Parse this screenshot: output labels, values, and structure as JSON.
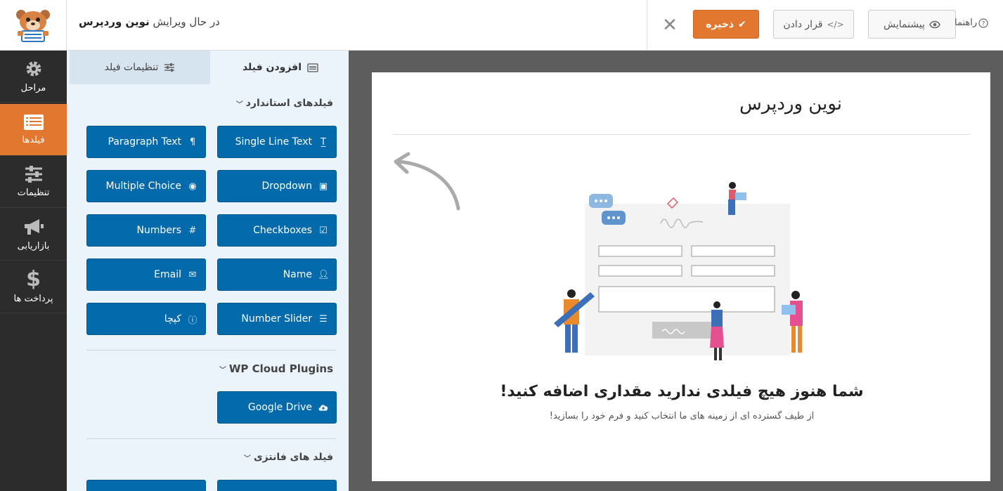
{
  "header": {
    "editing_prefix": "در حال ویرایش",
    "form_name": "نوین وردپرس",
    "save_label": "ذخیره",
    "embed_label": "قرار دادن",
    "preview_label": "پیشنمایش",
    "help_label": "راهنما"
  },
  "sidebar": {
    "items": [
      {
        "label": "مراحل",
        "icon": "gear-icon"
      },
      {
        "label": "فیلدها",
        "icon": "fields-icon"
      },
      {
        "label": "تنظیمات",
        "icon": "sliders-icon"
      },
      {
        "label": "بازاریابی",
        "icon": "megaphone-icon"
      },
      {
        "label": "پرداخت ها",
        "icon": "dollar-icon"
      }
    ]
  },
  "panel": {
    "tab_add": "افزودن فیلد",
    "tab_options": "تنظیمات فیلد",
    "standard_title": "فیلدهای استاندارد",
    "standard_fields": [
      {
        "label": "Single Line Text",
        "icon": "text-icon"
      },
      {
        "label": "Paragraph Text",
        "icon": "paragraph-icon"
      },
      {
        "label": "Dropdown",
        "icon": "dropdown-icon"
      },
      {
        "label": "Multiple Choice",
        "icon": "radio-icon"
      },
      {
        "label": "Checkboxes",
        "icon": "checkbox-icon"
      },
      {
        "label": "Numbers",
        "icon": "hash-icon"
      },
      {
        "label": "Name",
        "icon": "user-icon"
      },
      {
        "label": "Email",
        "icon": "envelope-icon"
      },
      {
        "label": "Number Slider",
        "icon": "slider-icon"
      },
      {
        "label": "کپچا",
        "icon": "question-icon"
      }
    ],
    "cloud_title": "WP Cloud Plugins",
    "cloud_fields": [
      {
        "label": "Google Drive",
        "icon": "cloud-upload-icon"
      }
    ],
    "fancy_title": "فیلد های فانتزی"
  },
  "canvas": {
    "form_title": "نوین وردپرس",
    "empty_heading": "شما هنوز هیچ فیلدی ندارید مقداری اضافه کنید!",
    "empty_sub": "از طیف گسترده ای از زمینه های ما انتخاب کنید و فرم خود را بسازید!"
  },
  "colors": {
    "accent": "#e27730",
    "field_button": "#036aab",
    "sidebar": "#2c2c2c",
    "panel_bg": "#ebf3fb"
  }
}
